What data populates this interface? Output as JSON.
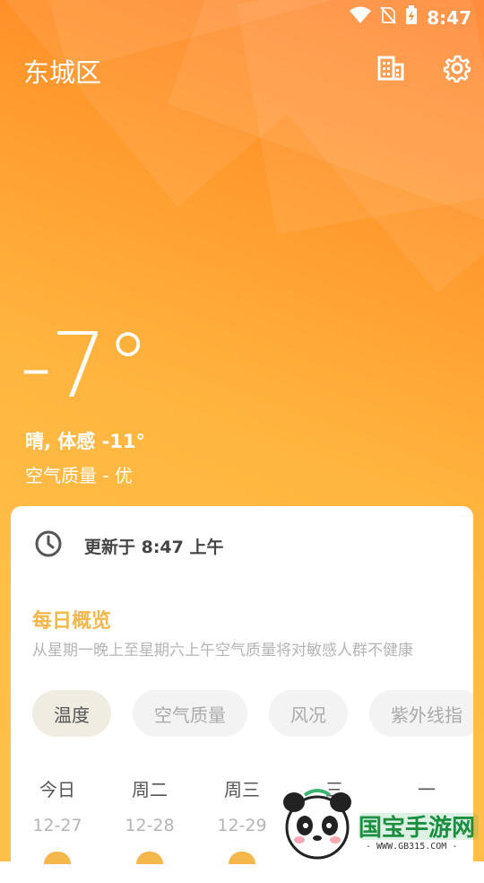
{
  "status": {
    "time": "8:47"
  },
  "header": {
    "city": "东城区"
  },
  "current": {
    "temperature": "-7°",
    "condition": "晴, 体感 -11°",
    "air_quality": "空气质量 - 优"
  },
  "card": {
    "updated": "更新于 8:47 上午",
    "overview_title": "每日概览",
    "overview_desc": "从星期一晚上至星期六上午空气质量将对敏感人群不健康",
    "chips": [
      "温度",
      "空气质量",
      "风况",
      "紫外线指"
    ],
    "days": [
      {
        "name": "今日",
        "date": "12-27"
      },
      {
        "name": "周二",
        "date": "12-28"
      },
      {
        "name": "周三",
        "date": "12-29"
      },
      {
        "name": "三",
        "date": ""
      },
      {
        "name": "一",
        "date": ""
      }
    ]
  },
  "watermark": {
    "brand": "国宝手游网",
    "url": "- WWW.GB315.COM -"
  },
  "colors": {
    "accent": "#f4b74c",
    "bg_top": "#ff7a1f",
    "bg_bottom": "#ffc04a"
  }
}
